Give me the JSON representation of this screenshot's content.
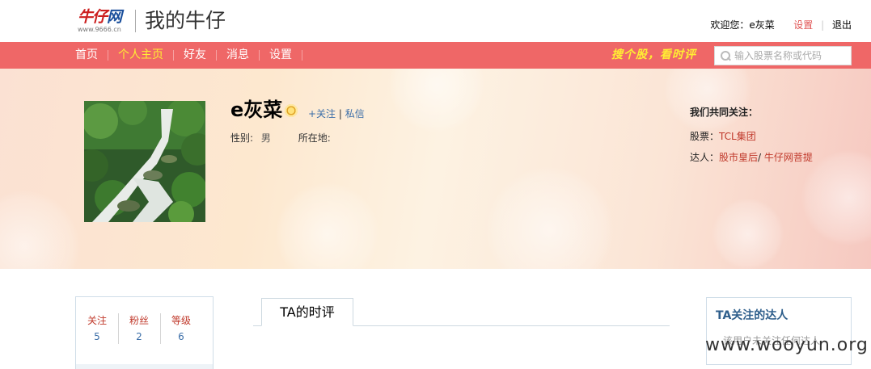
{
  "header": {
    "logo_main_red": "牛仔",
    "logo_main_blue": "网",
    "logo_sub": "www.9666.cn",
    "site_title": "我的牛仔",
    "welcome": "欢迎您：e灰菜",
    "settings_link": "设置",
    "logout_link": "退出"
  },
  "nav": {
    "items": [
      {
        "label": "首页"
      },
      {
        "label": "个人主页",
        "active": true
      },
      {
        "label": "好友"
      },
      {
        "label": "消息"
      },
      {
        "label": "设置"
      }
    ],
    "slogan": "搜个股，看时评",
    "search_placeholder": "输入股票名称或代码"
  },
  "profile": {
    "username": "e灰菜",
    "follow": "+关注",
    "divider": "|",
    "message": "私信",
    "gender_label": "性别:",
    "gender_value": "男",
    "location_label": "所在地:",
    "location_value": ""
  },
  "common": {
    "heading": "我们共同关注：",
    "stocks_label": "股票：",
    "stock_1": "TCL集团",
    "experts_label": "达人：",
    "expert_1": "股市皇后",
    "expert_sep": "/",
    "expert_2": "牛仔网菩提"
  },
  "stats": [
    {
      "label": "关注",
      "value": "5"
    },
    {
      "label": "粉丝",
      "value": "2"
    },
    {
      "label": "等级",
      "value": "6"
    }
  ],
  "main": {
    "tab_label": "TA的时评"
  },
  "follow_box": {
    "title": "TA关注的达人",
    "empty_text": "该用户未关注任何达人"
  },
  "watermark": "www.wooyun.org",
  "colors": {
    "nav_bg": "#ef6767",
    "nav_active": "#ffee33",
    "link_red": "#c0392b",
    "link_blue": "#3b6ea8"
  }
}
